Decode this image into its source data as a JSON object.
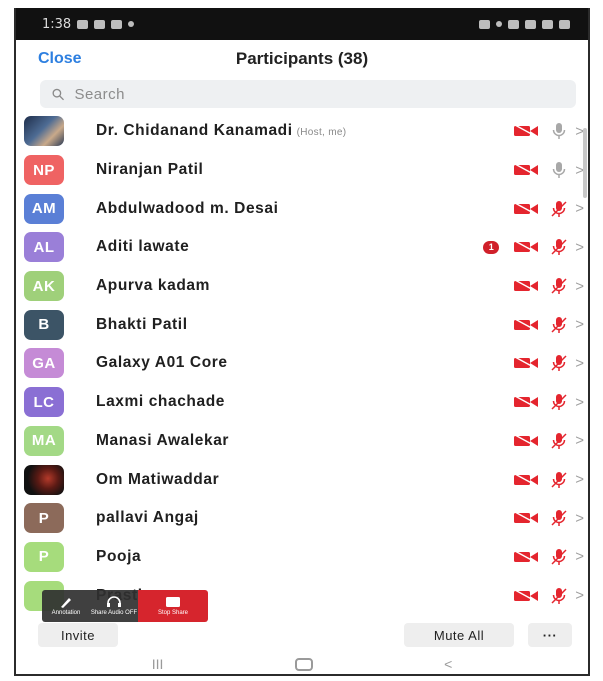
{
  "status_bar": {
    "time": "1:38"
  },
  "header": {
    "close_label": "Close",
    "title": "Participants (38)"
  },
  "search": {
    "placeholder": "Search"
  },
  "colors": {
    "accent": "#2d7fe0",
    "muted_red": "#e4252e",
    "badge": "#d0202a"
  },
  "participants": [
    {
      "avatar_type": "photo1",
      "initials": "",
      "avatar_color": "",
      "name": "Dr. Chidanand Kanamadi",
      "tag": "(Host, me)",
      "mic_icon": "mic-on-gray-icon",
      "badge": ""
    },
    {
      "avatar_type": "initials",
      "initials": "NP",
      "avatar_color": "#ef6363",
      "name": "Niranjan Patil",
      "tag": "",
      "mic_icon": "mic-on-gray-icon",
      "badge": ""
    },
    {
      "avatar_type": "initials",
      "initials": "AM",
      "avatar_color": "#5a7fd6",
      "name": "Abdulwadood m. Desai",
      "tag": "",
      "mic_icon": "mic-muted-red-icon",
      "badge": ""
    },
    {
      "avatar_type": "initials",
      "initials": "AL",
      "avatar_color": "#9a7fd8",
      "name": "Aditi lawate",
      "tag": "",
      "mic_icon": "mic-muted-red-icon",
      "badge": "1"
    },
    {
      "avatar_type": "initials",
      "initials": "AK",
      "avatar_color": "#9fd07a",
      "name": "Apurva kadam",
      "tag": "",
      "mic_icon": "mic-muted-red-icon",
      "badge": ""
    },
    {
      "avatar_type": "initials",
      "initials": "B",
      "avatar_color": "#3c5466",
      "name": "Bhakti Patil",
      "tag": "",
      "mic_icon": "mic-muted-red-icon",
      "badge": ""
    },
    {
      "avatar_type": "initials",
      "initials": "GA",
      "avatar_color": "#c58bd6",
      "name": "Galaxy A01 Core",
      "tag": "",
      "mic_icon": "mic-muted-red-icon",
      "badge": ""
    },
    {
      "avatar_type": "initials",
      "initials": "LC",
      "avatar_color": "#8a6fd4",
      "name": "Laxmi chachade",
      "tag": "",
      "mic_icon": "mic-muted-red-icon",
      "badge": ""
    },
    {
      "avatar_type": "initials",
      "initials": "MA",
      "avatar_color": "#a3d986",
      "name": "Manasi Awalekar",
      "tag": "",
      "mic_icon": "mic-muted-red-icon",
      "badge": ""
    },
    {
      "avatar_type": "photo2",
      "initials": "",
      "avatar_color": "",
      "name": "Om Matiwaddar",
      "tag": "",
      "mic_icon": "mic-muted-red-icon",
      "badge": ""
    },
    {
      "avatar_type": "initials",
      "initials": "P",
      "avatar_color": "#8c6a5a",
      "name": "pallavi Angaj",
      "tag": "",
      "mic_icon": "mic-muted-red-icon",
      "badge": ""
    },
    {
      "avatar_type": "initials",
      "initials": "P",
      "avatar_color": "#a6dc7c",
      "name": "Pooja",
      "tag": "",
      "mic_icon": "mic-muted-red-icon",
      "badge": ""
    },
    {
      "avatar_type": "initials",
      "initials": "",
      "avatar_color": "#a6dc7c",
      "name": "Prasti",
      "tag": "",
      "mic_icon": "mic-muted-red-icon",
      "badge": ""
    }
  ],
  "share_toolbar": {
    "annotation_label": "Annotation",
    "share_audio_label": "Share Audio OFF",
    "stop_share_label": "Stop Share"
  },
  "bottom_bar": {
    "invite_label": "Invite",
    "mute_all_label": "Mute All",
    "more_label": "···"
  },
  "nav_bar": {
    "recents_label": "III",
    "back_label": "<"
  }
}
